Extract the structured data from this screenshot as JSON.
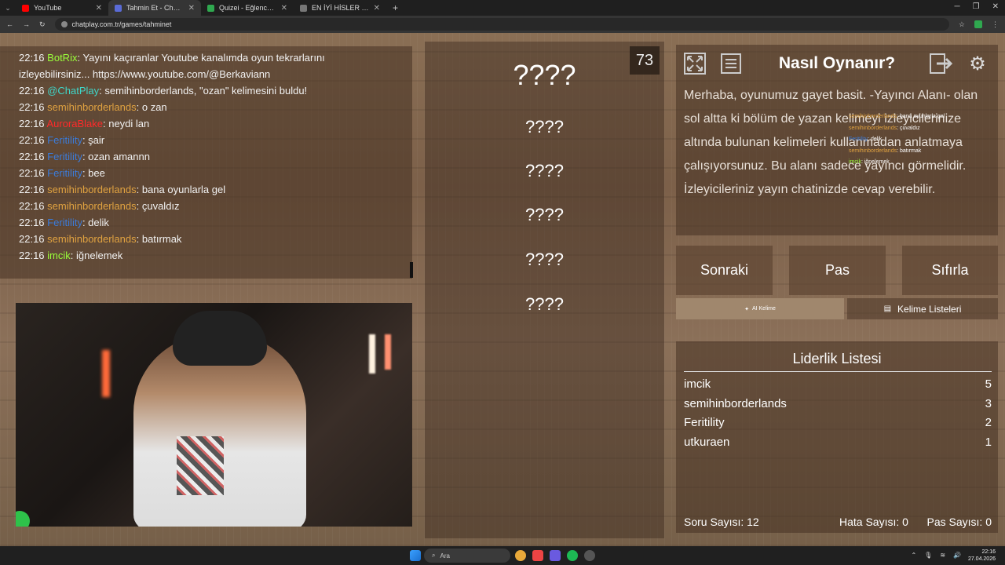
{
  "browser": {
    "tabs": [
      {
        "label": "YouTube",
        "color": "#ff0000",
        "active": false
      },
      {
        "label": "Tahmin Et - ChatPlay",
        "color": "#5a6bd6",
        "active": true
      },
      {
        "label": "Quizei - Eğlenceli ve etkileşimli...",
        "color": "#2fa84f",
        "active": false
      },
      {
        "label": "EN İYİ HİSLER - Tier List | Kör Sı...",
        "color": "#777777",
        "active": false
      }
    ],
    "url": "chatplay.com.tr/games/tahminet"
  },
  "chat": {
    "messages": [
      {
        "time": "22:16",
        "user": "BotRix",
        "color": "#9aff3a",
        "text": ": Yayını kaçıranlar Youtube kanalımda oyun tekrarlarını"
      },
      {
        "time": "",
        "user": "",
        "color": "#ffffff",
        "text": "izleyebilirsiniz... https://www.youtube.com/@Berkaviann"
      },
      {
        "time": "22:16",
        "user": "@ChatPlay",
        "color": "#3fd6c8",
        "text": ": semihinborderlands, \"ozan\" kelimesini buldu!"
      },
      {
        "time": "22:16",
        "user": "semihinborderlands",
        "color": "#e0a240",
        "text": ": o zan"
      },
      {
        "time": "22:16",
        "user": "AuroraBlake",
        "color": "#ff2a2a",
        "text": ": neydi lan"
      },
      {
        "time": "22:16",
        "user": "Feritility",
        "color": "#3b7bd9",
        "text": ": şair"
      },
      {
        "time": "22:16",
        "user": "Feritility",
        "color": "#3b7bd9",
        "text": ": ozan amannn"
      },
      {
        "time": "22:16",
        "user": "Feritility",
        "color": "#3b7bd9",
        "text": ": bee"
      },
      {
        "time": "22:16",
        "user": "semihinborderlands",
        "color": "#e0a240",
        "text": ": bana oyunlarla gel"
      },
      {
        "time": "22:16",
        "user": "semihinborderlands",
        "color": "#e0a240",
        "text": ": çuvaldız"
      },
      {
        "time": "22:16",
        "user": "Feritility",
        "color": "#3b7bd9",
        "text": ": delik"
      },
      {
        "time": "22:16",
        "user": "semihinborderlands",
        "color": "#e0a240",
        "text": ": batırmak"
      },
      {
        "time": "22:16",
        "user": "imcik",
        "color": "#9aff3a",
        "text": ": iğnelemek"
      }
    ]
  },
  "game": {
    "timer": "73",
    "words": [
      "????",
      "????",
      "????",
      "????",
      "????",
      "????"
    ]
  },
  "how": {
    "title": "Nasıl Oynanır?",
    "body": "Merhaba, oyunumuz gayet basit. -Yayıncı Alanı- olan sol altta ki bölüm de yazan kelimeyi izleyicilerinize altında bulunan kelimeleri kullanmadan anlatmaya çalışıyorsunuz. Bu alanı sadece yayıncı görmelidir. İzleyicileriniz yayın chatinizde cevap verebilir.",
    "overlay": [
      {
        "user": "semihinborderlands",
        "text": ": bana oyunlarla gel"
      },
      {
        "user": "semihinborderlands",
        "text": ": çuvaldız"
      },
      {
        "user": "Feritility",
        "text": ": delik"
      },
      {
        "user": "semihinborderlands",
        "text": ": batırmak"
      },
      {
        "user": "imcik",
        "text": ": iğnelemek"
      }
    ]
  },
  "actions": {
    "next": "Sonraki",
    "pass": "Pas",
    "reset": "Sıfırla",
    "ai_word": "AI Kelime",
    "word_lists": "Kelime Listeleri"
  },
  "leaderboard": {
    "title": "Liderlik Listesi",
    "rows": [
      {
        "name": "imcik",
        "score": "5"
      },
      {
        "name": "semihinborderlands",
        "score": "3"
      },
      {
        "name": "Feritility",
        "score": "2"
      },
      {
        "name": "utkuraen",
        "score": "1"
      }
    ],
    "question_count": "Soru Sayısı: 12",
    "error_count": "Hata Sayısı: 0",
    "pass_count": "Pas Sayısı: 0"
  },
  "taskbar": {
    "search": "Ara",
    "time": "22:16",
    "date": "27.04.2026"
  }
}
